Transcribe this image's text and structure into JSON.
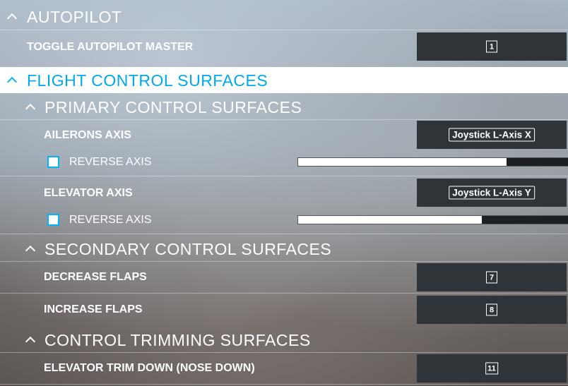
{
  "autopilot": {
    "header": "AUTOPILOT",
    "items": [
      {
        "label": "TOGGLE AUTOPILOT MASTER",
        "key": "1"
      }
    ]
  },
  "flight_control": {
    "header": "FLIGHT CONTROL SURFACES",
    "primary": {
      "header": "PRIMARY CONTROL SURFACES",
      "ailerons": {
        "label": "AILERONS AXIS",
        "binding": "Joystick L-Axis X",
        "reverse_label": "REVERSE AXIS",
        "axis_level": 0.77
      },
      "elevator": {
        "label": "ELEVATOR AXIS",
        "binding": "Joystick L-Axis Y",
        "reverse_label": "REVERSE AXIS",
        "axis_level": 0.68
      }
    },
    "secondary": {
      "header": "SECONDARY CONTROL SURFACES",
      "decrease_flaps": {
        "label": "DECREASE FLAPS",
        "key": "7"
      },
      "increase_flaps": {
        "label": "INCREASE FLAPS",
        "key": "8"
      }
    },
    "trimming": {
      "header": "CONTROL TRIMMING SURFACES",
      "elevator_trim_down": {
        "label": "ELEVATOR TRIM DOWN (NOSE DOWN)",
        "key": "11"
      }
    }
  },
  "colors": {
    "accent": "#00b4ff",
    "highlight_bg": "#ffffff",
    "binding_bg": "#2f3438"
  }
}
